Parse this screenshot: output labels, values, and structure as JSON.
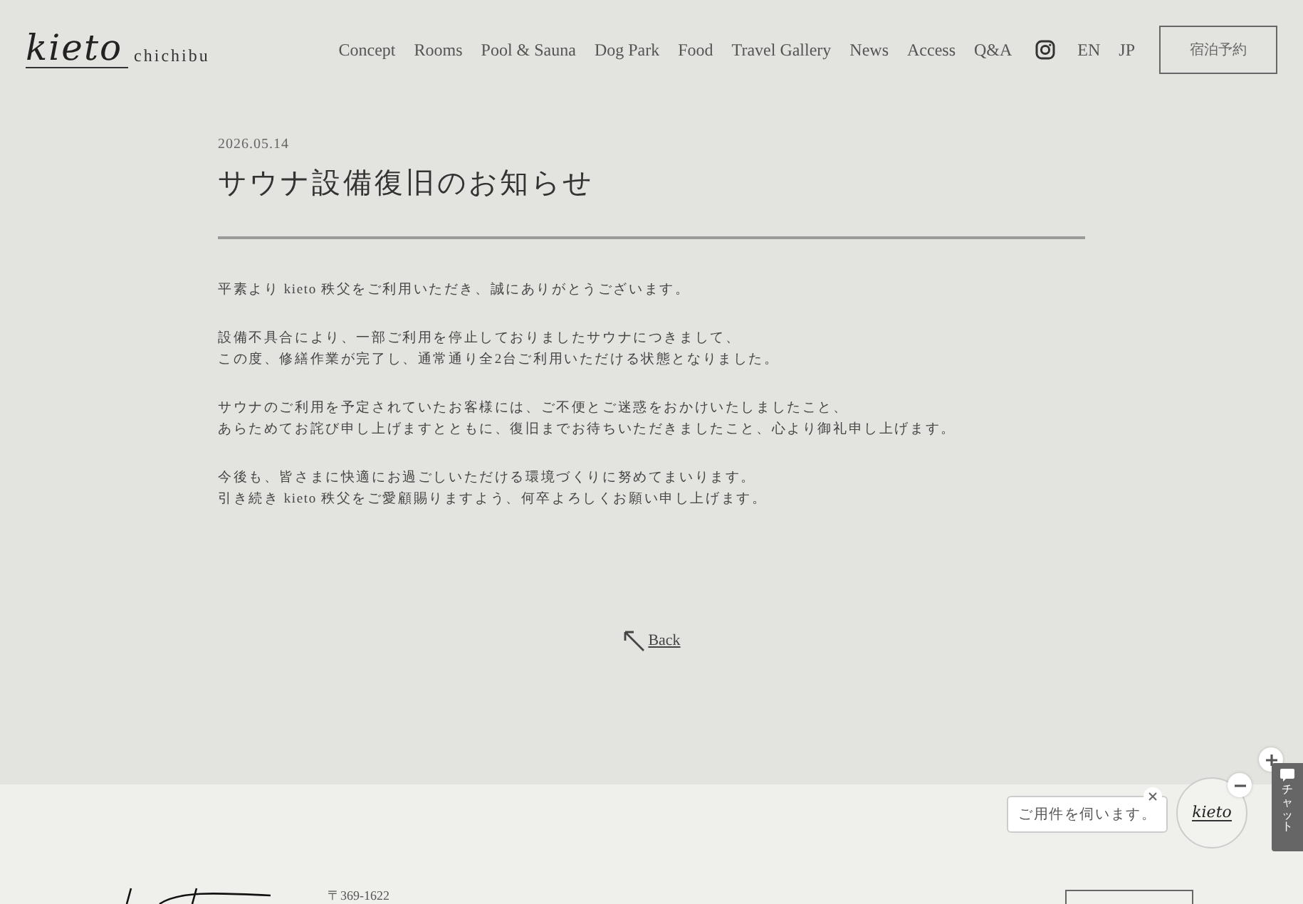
{
  "header": {
    "logo": {
      "wordmark": "kieto",
      "place": "chichibu"
    },
    "nav": [
      "Concept",
      "Rooms",
      "Pool & Sauna",
      "Dog Park",
      "Food",
      "Travel Gallery",
      "News",
      "Access",
      "Q&A"
    ],
    "languages": [
      "EN",
      "JP"
    ],
    "booking_button": "宿泊予約"
  },
  "article": {
    "date": "2026.05.14",
    "title": "サウナ設備復旧のお知らせ",
    "paragraphs": [
      [
        "平素より kieto 秩父をご利用いただき、誠にありがとうございます。"
      ],
      [
        "設備不具合により、一部ご利用を停止しておりましたサウナにつきまして、",
        "この度、修繕作業が完了し、通常通り全2台ご利用いただける状態となりました。"
      ],
      [
        "サウナのご利用を予定されていたお客様には、ご不便とご迷惑をおかけいたしましたこと、",
        "あらためてお詫び申し上げますとともに、復旧までお待ちいただきましたこと、心より御礼申し上げます。"
      ],
      [
        "今後も、皆さまに快適にお過ごしいただける環境づくりに努めてまいります。",
        "引き続き kieto 秩父をご愛顧賜りますよう、何卒よろしくお願い申し上げます。"
      ]
    ]
  },
  "back_link": "Back",
  "chat": {
    "greeting": "ご用件を伺います。",
    "avatar_wordmark": "kieto",
    "tab_label": "チャット"
  },
  "footer": {
    "postal_code": "〒369-1622"
  }
}
